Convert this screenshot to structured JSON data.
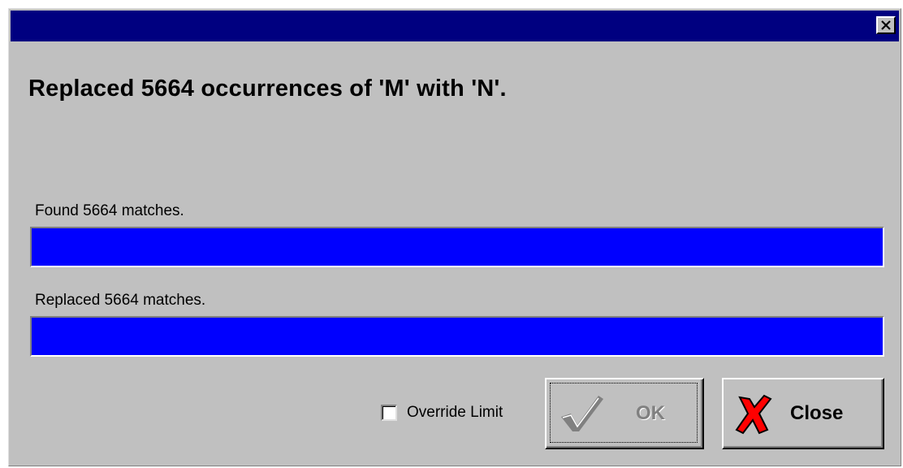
{
  "dialog": {
    "title": "",
    "headline": "Replaced 5664 occurrences of 'M' with 'N'."
  },
  "progress": {
    "found_label": "Found 5664 matches.",
    "found_fraction": 1.0,
    "replaced_label": "Replaced 5664 matches.",
    "replaced_fraction": 1.0,
    "fill_color": "#0000ff"
  },
  "options": {
    "override_label": "Override Limit",
    "override_checked": false
  },
  "buttons": {
    "ok_label": "OK",
    "ok_enabled": false,
    "close_label": "Close"
  },
  "icons": {
    "titlebar_close": "close-x-icon",
    "ok": "checkmark-icon",
    "close": "red-x-icon"
  }
}
